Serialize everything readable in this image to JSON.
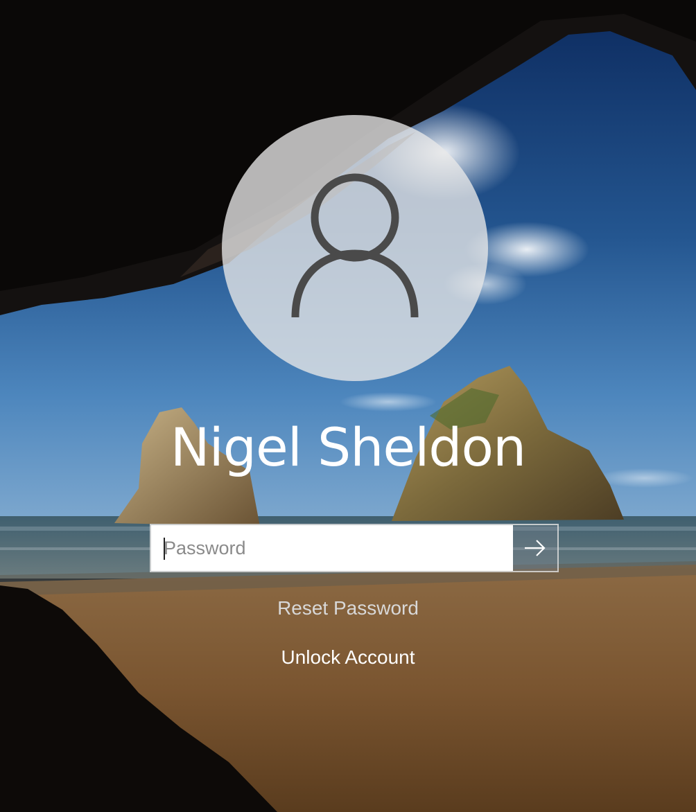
{
  "login": {
    "user_name": "Nigel Sheldon",
    "password_placeholder": "Password",
    "password_value": "",
    "reset_password_label": "Reset Password",
    "unlock_account_label": "Unlock Account"
  },
  "icons": {
    "avatar": "user-silhouette-icon",
    "submit": "arrow-right-icon"
  },
  "colors": {
    "text": "#ffffff",
    "input_background": "#ffffff",
    "avatar_background": "#e8e8e8"
  }
}
